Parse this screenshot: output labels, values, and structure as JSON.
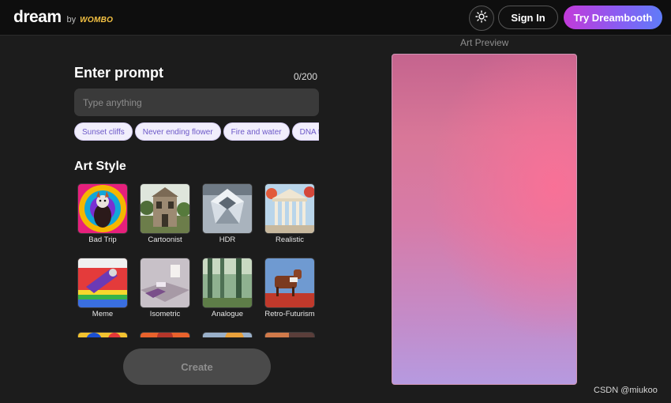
{
  "header": {
    "logo": {
      "name": "dream",
      "by": "by",
      "brand": "WOMBO"
    },
    "theme_icon": "sun-icon",
    "sign_in_label": "Sign In",
    "dreambooth_label": "Try Dreambooth",
    "colors": {
      "dreambooth_gradient": [
        "#c23ad9",
        "#5f7cf8"
      ]
    }
  },
  "prompt": {
    "title": "Enter prompt",
    "count": "0/200",
    "placeholder": "Type anything",
    "suggestions": [
      "Sunset cliffs",
      "Never ending flower",
      "Fire and water",
      "DNA tornado"
    ]
  },
  "art_style": {
    "title": "Art Style",
    "styles": [
      "Bad Trip",
      "Cartoonist",
      "HDR",
      "Realistic",
      "Meme",
      "Isometric",
      "Analogue",
      "Retro-Futurism",
      "",
      "",
      "",
      ""
    ]
  },
  "create_label": "Create",
  "preview": {
    "label": "Art Preview"
  },
  "watermark": "CSDN @miukoo"
}
